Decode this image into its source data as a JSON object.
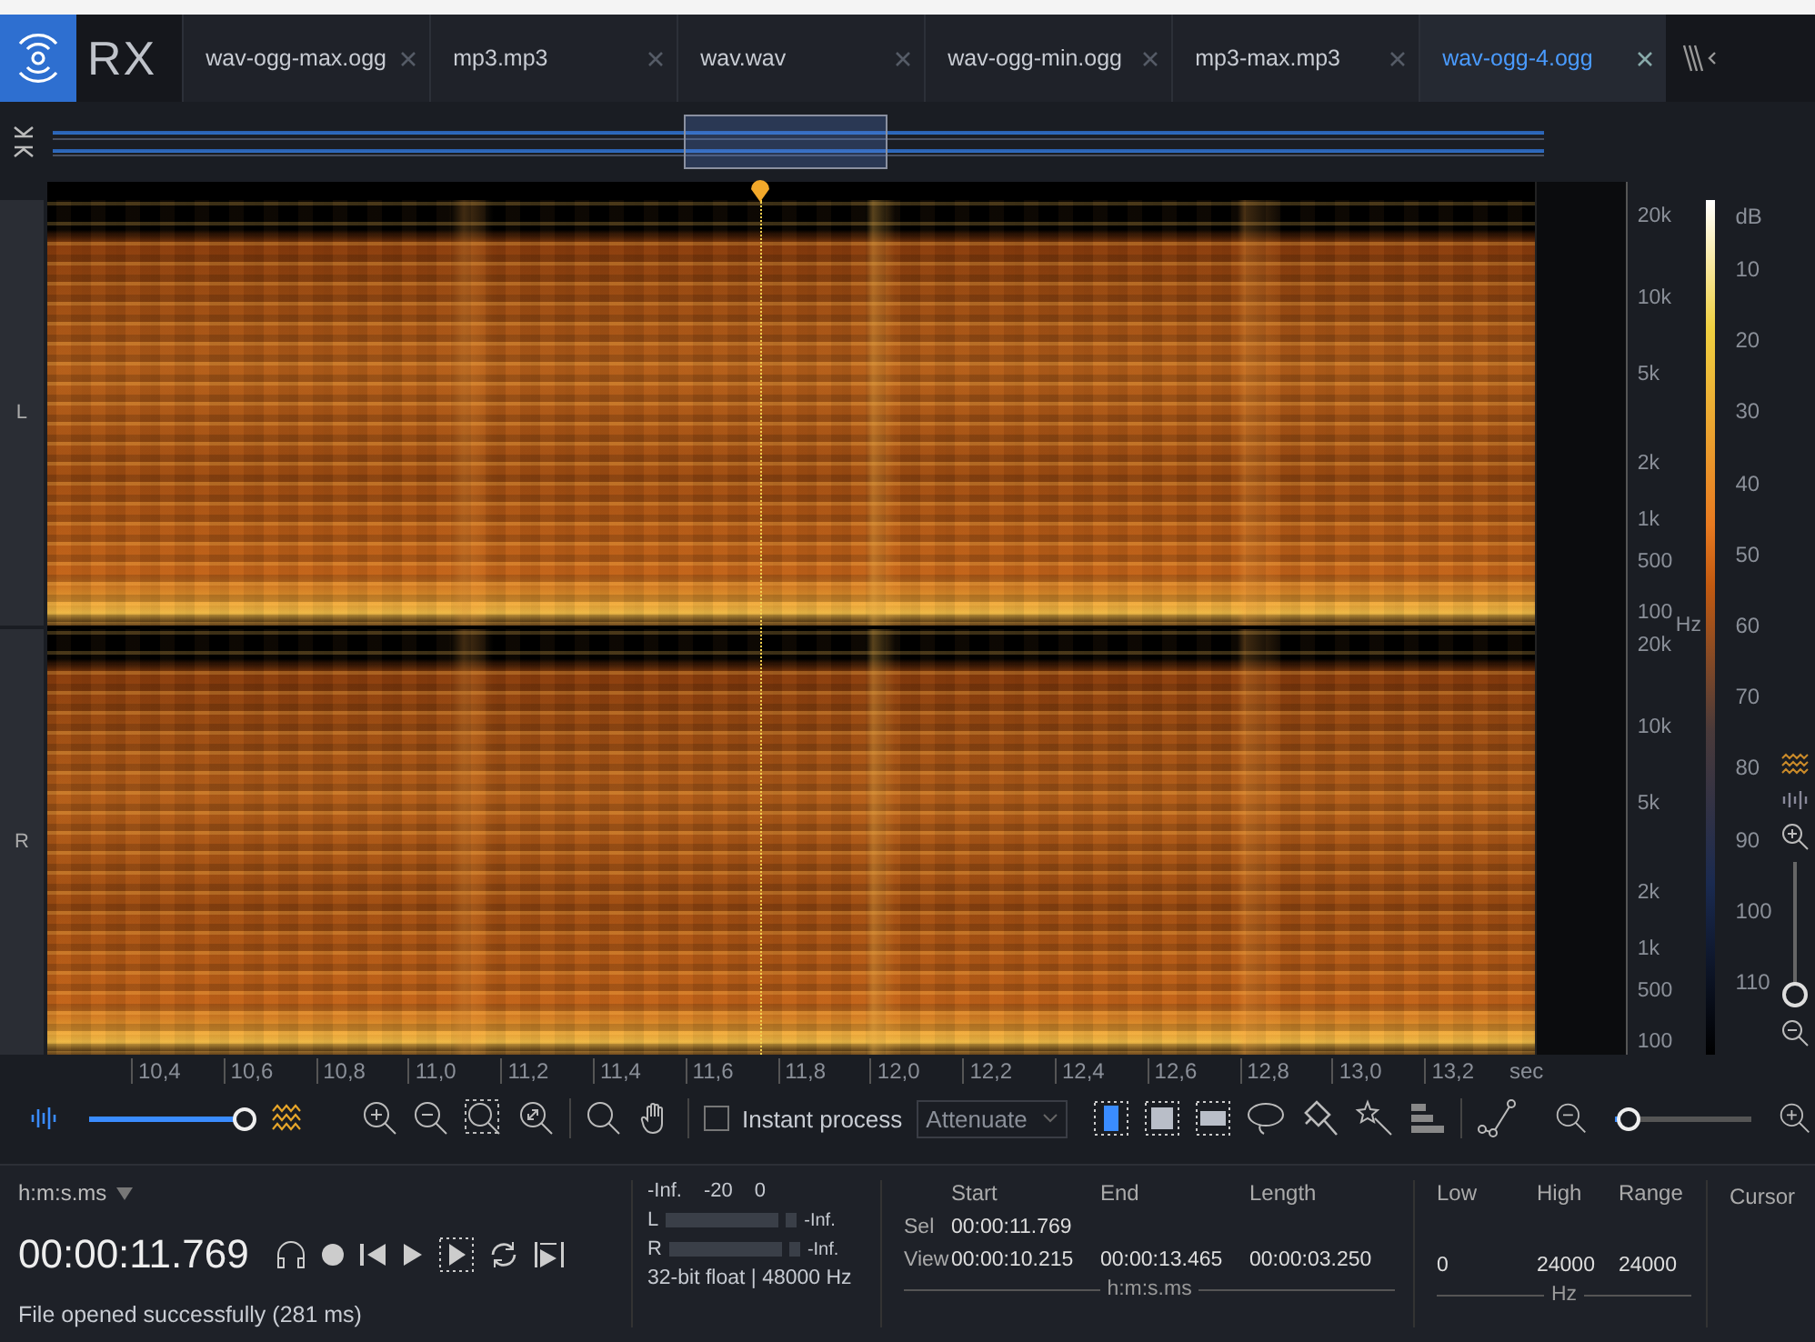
{
  "tabs": [
    {
      "label": "wav-ogg-max.ogg",
      "selected": false
    },
    {
      "label": "mp3.mp3",
      "selected": false
    },
    {
      "label": "wav.wav",
      "selected": false
    },
    {
      "label": "wav-ogg-min.ogg",
      "selected": false
    },
    {
      "label": "mp3-max.mp3",
      "selected": false
    },
    {
      "label": "wav-ogg-4.ogg",
      "selected": true
    }
  ],
  "logo_text": "RX",
  "channels": [
    {
      "label": "L",
      "freq_ticks": [
        "20k",
        "10k",
        "5k",
        "2k",
        "1k",
        "500",
        "100"
      ]
    },
    {
      "label": "R",
      "freq_ticks": [
        "20k",
        "10k",
        "5k",
        "2k",
        "1k",
        "500",
        "100"
      ]
    }
  ],
  "freq_unit": "Hz",
  "db_scale": {
    "unit": "dB",
    "ticks": [
      "10",
      "20",
      "30",
      "40",
      "50",
      "60",
      "70",
      "80",
      "90",
      "100",
      "110"
    ]
  },
  "time_axis": {
    "ticks": [
      "10,4",
      "10,6",
      "10,8",
      "11,0",
      "11,2",
      "11,4",
      "11,6",
      "11,8",
      "12,0",
      "12,2",
      "12,4",
      "12,6",
      "12,8",
      "13,0",
      "13,2"
    ],
    "unit": "sec"
  },
  "toolbar": {
    "view_blend": {
      "level": 1.0
    },
    "instant_process": {
      "label": "Instant process",
      "checked": false
    },
    "mode": "Attenuate",
    "tools": [
      {
        "kind": "time",
        "selected": true
      },
      {
        "kind": "rect",
        "selected": false
      },
      {
        "kind": "freq",
        "selected": false
      }
    ],
    "zoom": {
      "level": 0.1
    }
  },
  "vertical_zoom": {
    "level": 0.0
  },
  "transport": {
    "format": "h:m:s.ms",
    "time": "00:00:11.769",
    "status": "File opened successfully (281 ms)"
  },
  "meter": {
    "scale": [
      "-Inf.",
      "-20",
      "0"
    ],
    "channels": [
      {
        "label": "L",
        "reading": "-Inf."
      },
      {
        "label": "R",
        "reading": "-Inf."
      }
    ],
    "format": "32-bit float | 48000 Hz"
  },
  "selection": {
    "columns": [
      "Start",
      "End",
      "Length"
    ],
    "rows": [
      {
        "label": "Sel",
        "values": [
          "00:00:11.769"
        ]
      },
      {
        "label": "View",
        "values": [
          "00:00:10.215",
          "00:00:13.465",
          "00:00:03.250"
        ]
      }
    ],
    "unit": "h:m:s.ms"
  },
  "frequency": {
    "columns": [
      "Low",
      "High",
      "Range"
    ],
    "values": [
      "0",
      "24000",
      "24000"
    ],
    "unit": "Hz"
  },
  "cursor": {
    "label": "Cursor"
  }
}
